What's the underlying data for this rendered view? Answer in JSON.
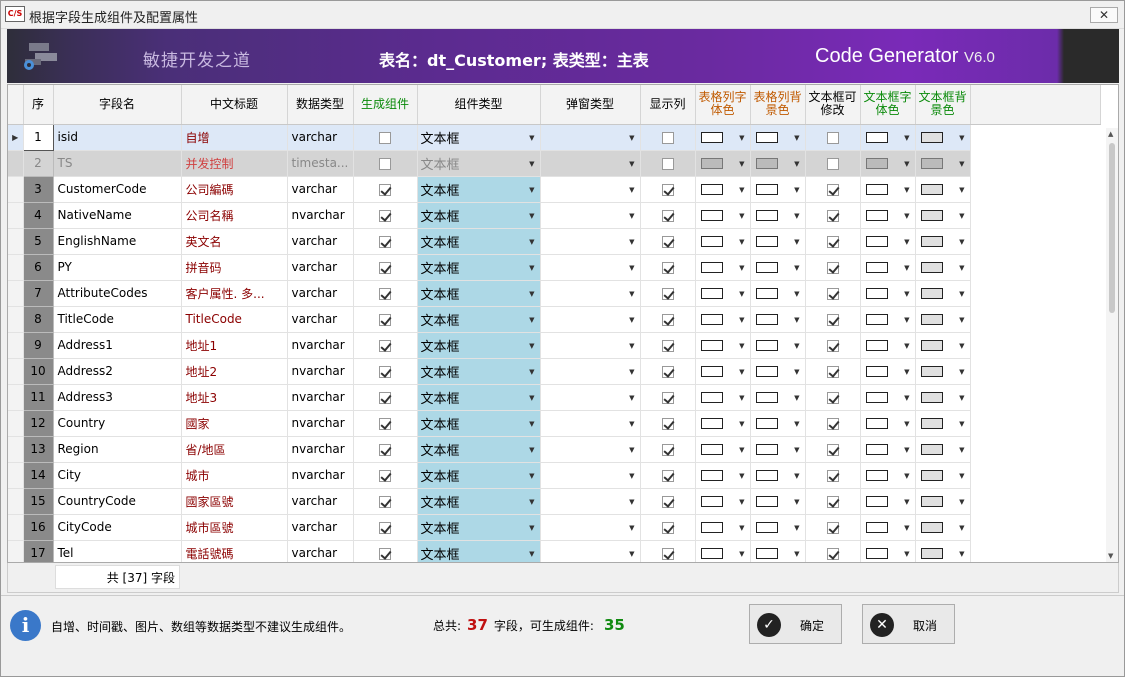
{
  "window": {
    "title": "根据字段生成组件及配置属性",
    "app_icon": "C/S",
    "close_label": "✕"
  },
  "banner": {
    "slogan": "敏捷开发之道",
    "table_info": "表名：dt_Customer;   表类型：主表",
    "brand": "Code Generator",
    "version": "V6.0"
  },
  "columns": [
    "序",
    "字段名",
    "中文标题",
    "数据类型",
    "生成组件",
    "组件类型",
    "弹窗类型",
    "显示列",
    "表格列字体色",
    "表格列背景色",
    "文本框可修改",
    "文本框字体色",
    "文本框背景色"
  ],
  "rows": [
    {
      "seq": "1",
      "field": "isid",
      "title": "自增",
      "type": "varchar",
      "gen": false,
      "comp": "文本框",
      "show": false,
      "editable": false
    },
    {
      "seq": "2",
      "field": "TS",
      "title": "并发控制",
      "type": "timesta...",
      "gen": false,
      "comp": "文本框",
      "show": false,
      "editable": false
    },
    {
      "seq": "3",
      "field": "CustomerCode",
      "title": "公司編碼",
      "type": "varchar",
      "gen": true,
      "comp": "文本框",
      "show": true,
      "editable": true
    },
    {
      "seq": "4",
      "field": "NativeName",
      "title": "公司名稱",
      "type": "nvarchar",
      "gen": true,
      "comp": "文本框",
      "show": true,
      "editable": true
    },
    {
      "seq": "5",
      "field": "EnglishName",
      "title": "英文名",
      "type": "varchar",
      "gen": true,
      "comp": "文本框",
      "show": true,
      "editable": true
    },
    {
      "seq": "6",
      "field": "PY",
      "title": "拼音码",
      "type": "varchar",
      "gen": true,
      "comp": "文本框",
      "show": true,
      "editable": true
    },
    {
      "seq": "7",
      "field": "AttributeCodes",
      "title": "客户属性. 多...",
      "type": "varchar",
      "gen": true,
      "comp": "文本框",
      "show": true,
      "editable": true
    },
    {
      "seq": "8",
      "field": "TitleCode",
      "title": "TitleCode",
      "type": "varchar",
      "gen": true,
      "comp": "文本框",
      "show": true,
      "editable": true
    },
    {
      "seq": "9",
      "field": "Address1",
      "title": "地址1",
      "type": "nvarchar",
      "gen": true,
      "comp": "文本框",
      "show": true,
      "editable": true
    },
    {
      "seq": "10",
      "field": "Address2",
      "title": "地址2",
      "type": "nvarchar",
      "gen": true,
      "comp": "文本框",
      "show": true,
      "editable": true
    },
    {
      "seq": "11",
      "field": "Address3",
      "title": "地址3",
      "type": "nvarchar",
      "gen": true,
      "comp": "文本框",
      "show": true,
      "editable": true
    },
    {
      "seq": "12",
      "field": "Country",
      "title": "國家",
      "type": "nvarchar",
      "gen": true,
      "comp": "文本框",
      "show": true,
      "editable": true
    },
    {
      "seq": "13",
      "field": "Region",
      "title": "省/地區",
      "type": "nvarchar",
      "gen": true,
      "comp": "文本框",
      "show": true,
      "editable": true
    },
    {
      "seq": "14",
      "field": "City",
      "title": "城市",
      "type": "nvarchar",
      "gen": true,
      "comp": "文本框",
      "show": true,
      "editable": true
    },
    {
      "seq": "15",
      "field": "CountryCode",
      "title": "國家區號",
      "type": "varchar",
      "gen": true,
      "comp": "文本框",
      "show": true,
      "editable": true
    },
    {
      "seq": "16",
      "field": "CityCode",
      "title": "城市區號",
      "type": "varchar",
      "gen": true,
      "comp": "文本框",
      "show": true,
      "editable": true
    },
    {
      "seq": "17",
      "field": "Tel",
      "title": "電話號碼",
      "type": "varchar",
      "gen": true,
      "comp": "文本框",
      "show": true,
      "editable": true
    }
  ],
  "footer": {
    "count": "共 [37] 字段"
  },
  "bottom": {
    "hint": "自增、时间戳、图片、数组等数据类型不建议生成组件。",
    "total_label": "总共:",
    "total": "37",
    "mid_label": "字段，可生成组件:",
    "gen_count": "35",
    "ok_label": "确定",
    "cancel_label": "取消"
  },
  "colors": {
    "banner": "#5b2b8f",
    "selected_row": "#dde8f7",
    "combo_cell": "#add8e6",
    "total": "#c01010",
    "gen_count": "#108a10"
  }
}
